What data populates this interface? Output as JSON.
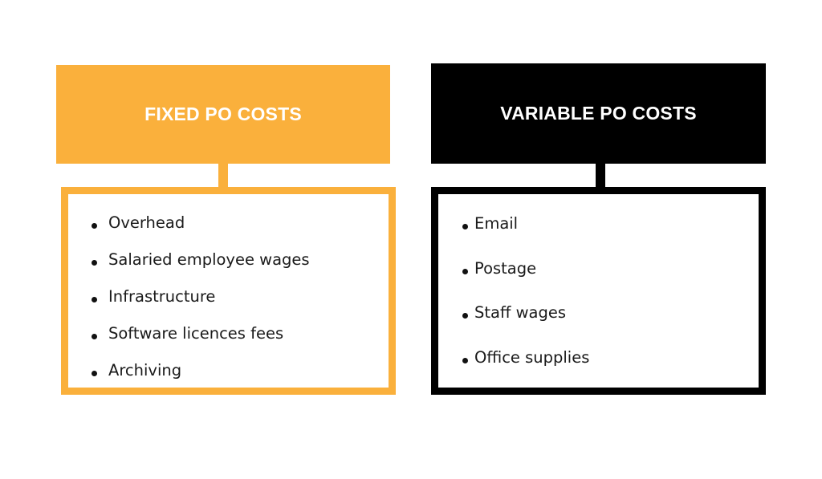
{
  "fixed": {
    "title": "FIXED PO COSTS",
    "color": "#FAB03C",
    "items": [
      "Overhead",
      "Salaried employee wages",
      "Infrastructure",
      "Software licences fees",
      "Archiving"
    ]
  },
  "variable": {
    "title": "VARIABLE PO COSTS",
    "color": "#000000",
    "items": [
      "Email",
      "Postage",
      "Staff wages",
      "Office supplies"
    ]
  }
}
